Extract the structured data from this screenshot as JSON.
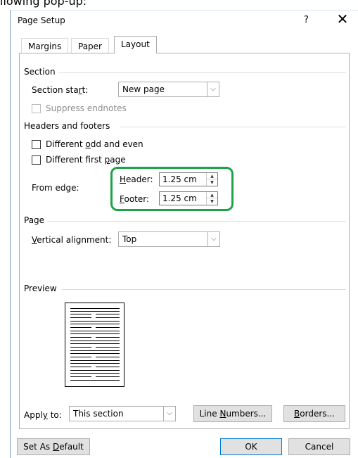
{
  "caption": {
    "text": "llowing pop-up:"
  },
  "dialog": {
    "title": "Page Setup",
    "help_symbol": "?",
    "close_symbol": "✕",
    "tabs": [
      {
        "label": "Margins",
        "active": false
      },
      {
        "label": "Paper",
        "active": false
      },
      {
        "label": "Layout",
        "active": true
      }
    ],
    "section": {
      "title": "Section",
      "start_label": "Section start:",
      "start_value": "New page",
      "suppress_endnotes_label": "Suppress endnotes",
      "suppress_endnotes_checked": false
    },
    "headers_footers": {
      "title": "Headers and footers",
      "odd_even_label": "Different odd and even",
      "odd_even_checked": false,
      "first_page_label": "Different first page",
      "first_page_checked": false,
      "from_edge_label": "From edge:",
      "header_label": "Header:",
      "header_value": "1.25 cm",
      "footer_label": "Footer:",
      "footer_value": "1.25 cm"
    },
    "page": {
      "title": "Page",
      "vertical_alignment_label": "Vertical alignment:",
      "vertical_alignment_value": "Top"
    },
    "preview": {
      "title": "Preview"
    },
    "apply": {
      "label": "Apply to:",
      "value": "This section"
    },
    "buttons": {
      "line_numbers": "Line Numbers...",
      "borders": "Borders...",
      "set_default": "Set As Default",
      "ok": "OK",
      "cancel": "Cancel"
    },
    "colors": {
      "highlight": "#1fa34a",
      "default_button_border": "#0078d7"
    }
  }
}
